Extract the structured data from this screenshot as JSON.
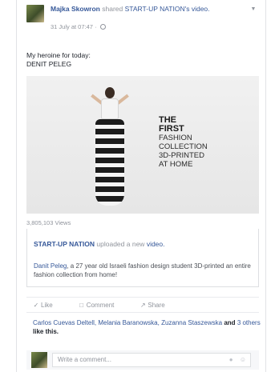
{
  "post": {
    "author": "Majka Skowron",
    "shared_text": "shared",
    "page": "START-UP NATION",
    "possessive": "'s",
    "object": "video.",
    "timestamp": "31 July at 07:47",
    "privacy_icon": "globe-icon",
    "caret_icon": "chevron-down-icon",
    "status_line1": "My heroine for today:",
    "status_line2": "DENIT PELEG"
  },
  "video": {
    "text_the": "THE",
    "text_first": "FIRST",
    "text_line3": "FASHION",
    "text_line4": "COLLECTION",
    "text_line5": "3D-PRINTED",
    "text_line6": "AT HOME",
    "views": "3,805,103 Views"
  },
  "attachment": {
    "page": "START-UP NATION",
    "uploaded_text": "uploaded a new",
    "video_link": "video.",
    "person": "Danit Peleg",
    "description": ", a 27 year old Israeli fashion design student 3D-printed an entire fashion collection from home!"
  },
  "actions": {
    "like": "Like",
    "comment": "Comment",
    "share": "Share"
  },
  "likes": {
    "names": "Carlos Cuevas Deltell, Melania Baranowska, Zuzanna Staszewska",
    "and_text": "and",
    "others": "3 others",
    "like_this": "like this."
  },
  "comment": {
    "placeholder": "Write a comment...",
    "camera_icon": "camera-icon",
    "emoji_icon": "emoji-icon"
  },
  "colors": {
    "link": "#365899",
    "muted": "#90949c",
    "border": "#dddfe2"
  }
}
